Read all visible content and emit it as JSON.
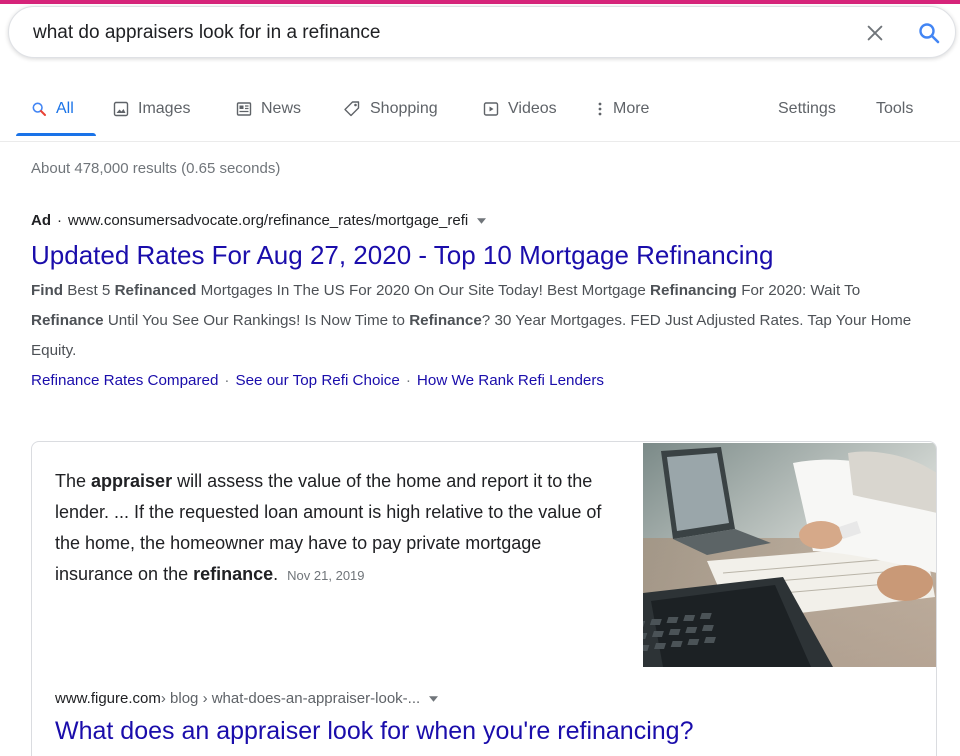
{
  "search": {
    "query": "what do appraisers look for in a refinance"
  },
  "tabs": [
    {
      "label": "All",
      "icon": "search-icon"
    },
    {
      "label": "Images",
      "icon": "image-icon"
    },
    {
      "label": "News",
      "icon": "news-icon"
    },
    {
      "label": "Shopping",
      "icon": "tag-icon"
    },
    {
      "label": "Videos",
      "icon": "play-icon"
    },
    {
      "label": "More",
      "icon": "more-vertical-icon"
    }
  ],
  "tools": {
    "settings": "Settings",
    "tools": "Tools"
  },
  "result_stats": "About 478,000 results (0.65 seconds)",
  "ad": {
    "label": "Ad",
    "separator": "·",
    "url": "www.consumersadvocate.org/refinance_rates/mortgage_refi",
    "title": "Updated Rates For Aug 27, 2020 - Top 10 Mortgage Refinancing",
    "description": [
      {
        "text": "Find",
        "bold": true
      },
      {
        "text": " Best 5 ",
        "bold": false
      },
      {
        "text": "Refinanced",
        "bold": true
      },
      {
        "text": " Mortgages In The US For 2020 On Our Site Today! Best Mortgage ",
        "bold": false
      },
      {
        "text": "Refinancing",
        "bold": true
      },
      {
        "text": " For 2020: Wait To ",
        "bold": false
      },
      {
        "text": "Refinance",
        "bold": true
      },
      {
        "text": " Until You See Our Rankings! Is Now Time to ",
        "bold": false
      },
      {
        "text": "Refinance",
        "bold": true
      },
      {
        "text": "? 30 Year Mortgages. FED Just Adjusted Rates. Tap Your Home Equity.",
        "bold": false
      }
    ],
    "sitelinks": [
      "Refinance Rates Compared",
      "See our Top Refi Choice",
      "How We Rank Refi Lenders"
    ],
    "sitelink_separator": "·"
  },
  "featured": {
    "snippet": [
      {
        "text": "The ",
        "bold": false
      },
      {
        "text": "appraiser",
        "bold": true
      },
      {
        "text": " will assess the value of the home and report it to the lender. ... If the requested loan amount is high relative to the value of the home, the homeowner may have to pay private mortgage insurance on the ",
        "bold": false
      },
      {
        "text": "refinance",
        "bold": true
      },
      {
        "text": ".",
        "bold": false
      }
    ],
    "date": "Nov 21, 2019",
    "source_domain": "www.figure.com",
    "breadcrumb": " › blog › what-does-an-appraiser-look-...",
    "title": "What does an appraiser look for when you're refinancing?"
  },
  "colors": {
    "accent": "#1a73e8",
    "link": "#1a0dab",
    "top_strip": "#d6247a"
  }
}
